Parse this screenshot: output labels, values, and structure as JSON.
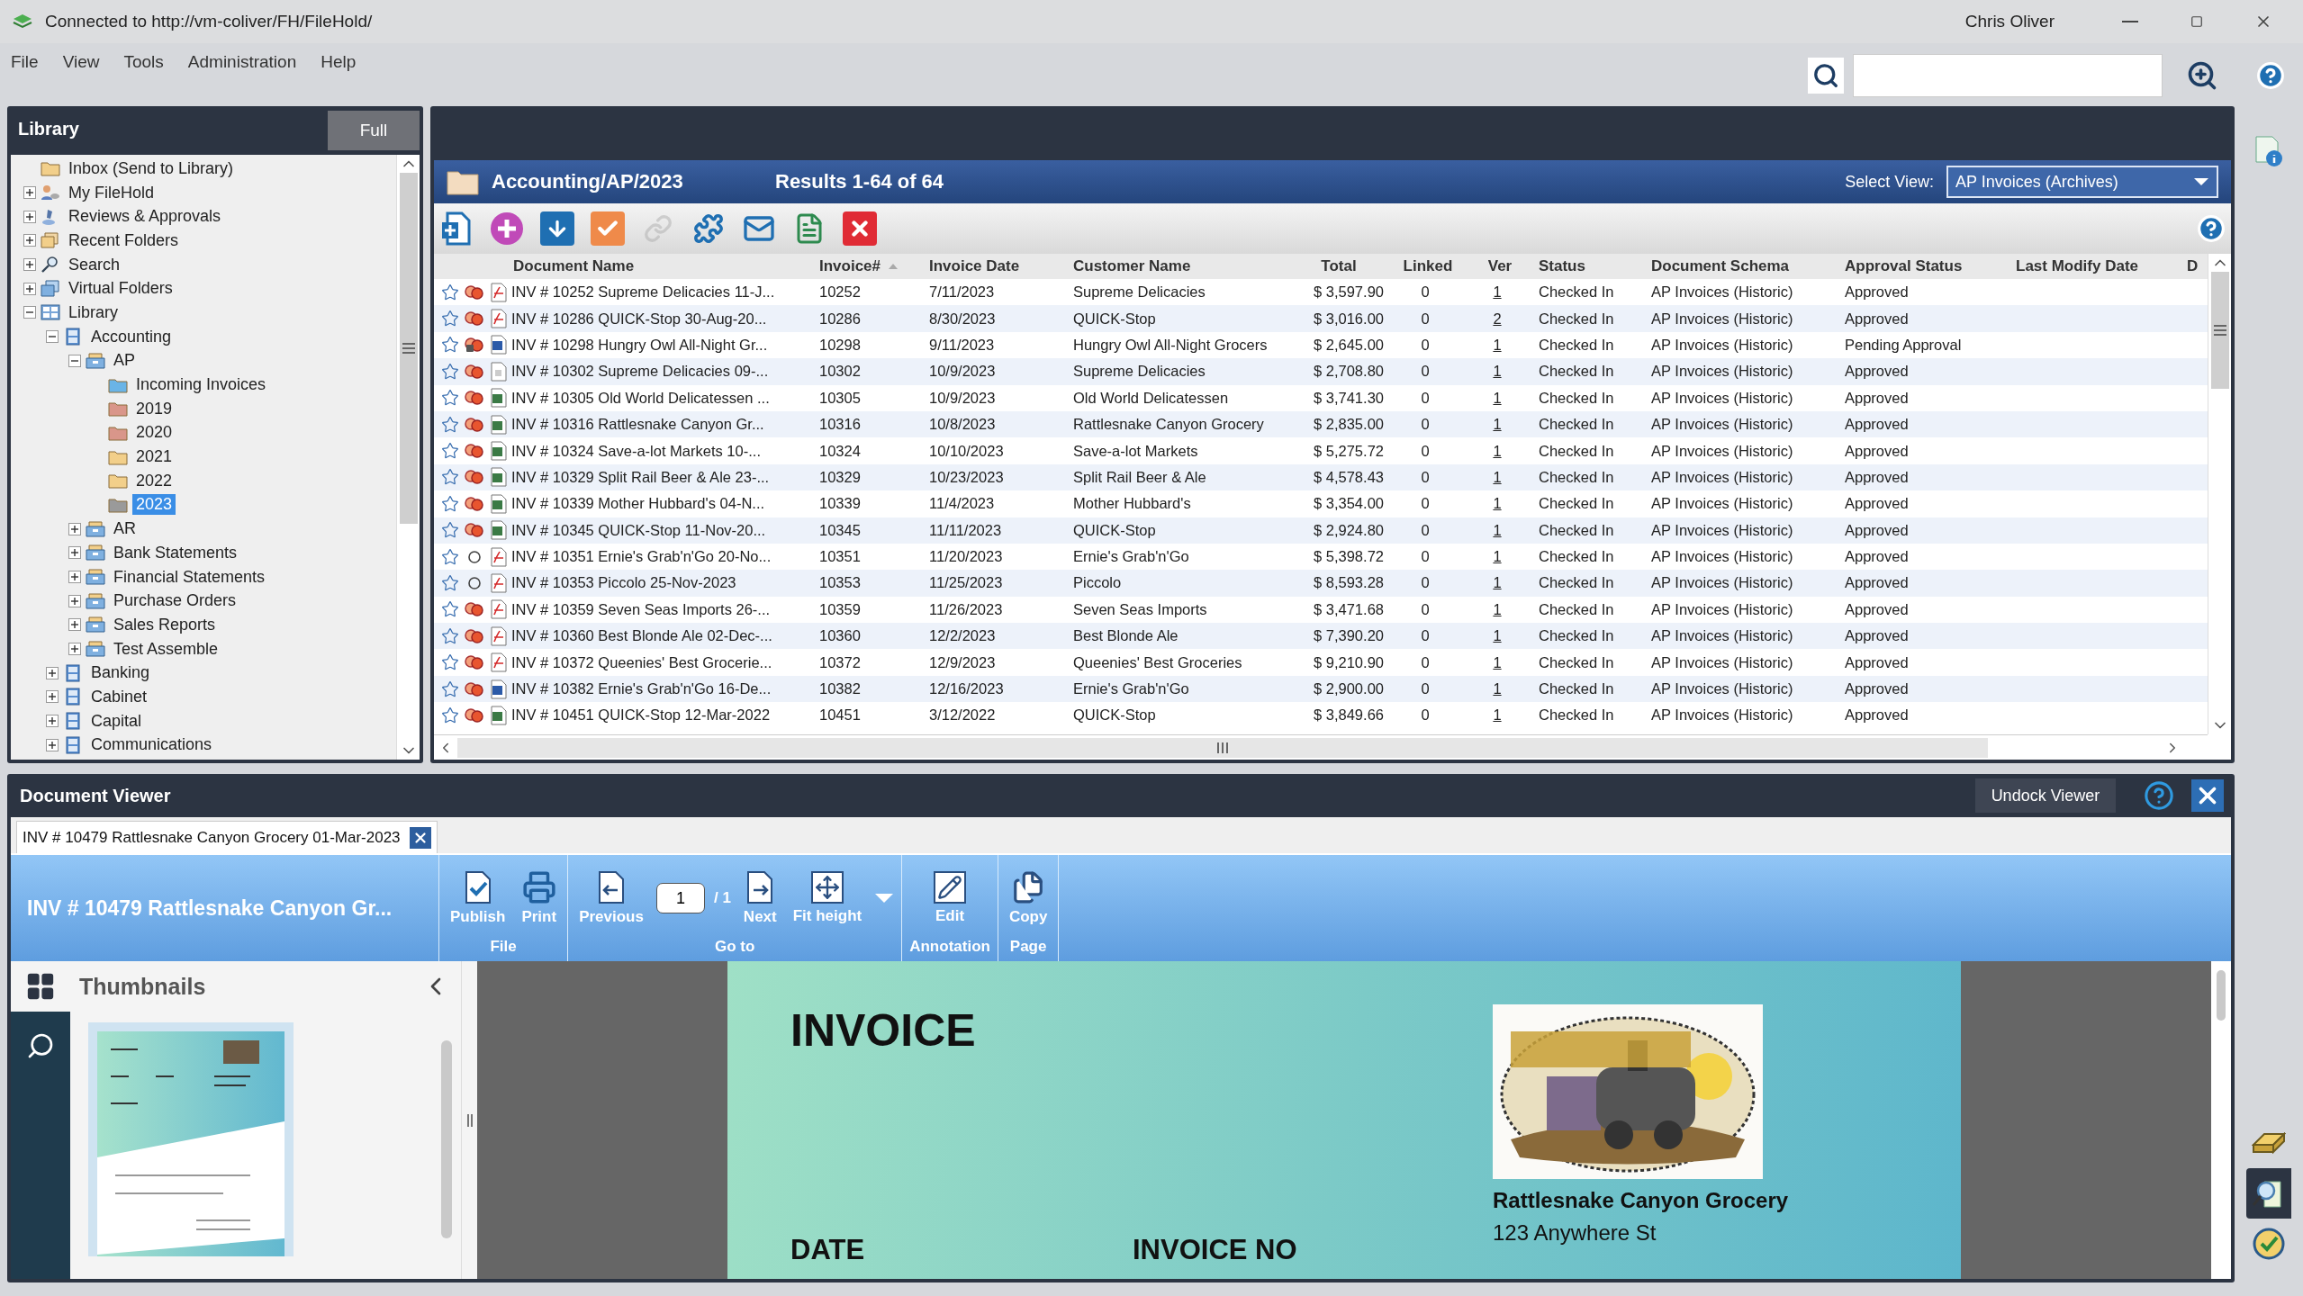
{
  "window": {
    "title": "Connected to http://vm-coliver/FH/FileHold/",
    "user": "Chris Oliver"
  },
  "menu": [
    "File",
    "View",
    "Tools",
    "Administration",
    "Help"
  ],
  "library": {
    "title": "Library",
    "mode_button": "Full",
    "tree": [
      {
        "label": "Inbox (Send to Library)",
        "kind": "folder",
        "color": "#f2cf8a",
        "selected": false
      },
      {
        "label": "My FileHold",
        "kind": "user",
        "expanded": false,
        "selected": false
      },
      {
        "label": "Reviews & Approvals",
        "kind": "reviews",
        "expanded": false,
        "selected": false
      },
      {
        "label": "Recent Folders",
        "kind": "recent",
        "expanded": false,
        "selected": false
      },
      {
        "label": "Search",
        "kind": "search",
        "expanded": false,
        "selected": false
      },
      {
        "label": "Virtual Folders",
        "kind": "virtual",
        "expanded": false,
        "selected": false
      },
      {
        "label": "Library",
        "kind": "library",
        "expanded": true,
        "selected": false,
        "children": [
          {
            "label": "Accounting",
            "kind": "cabinet",
            "expanded": true,
            "selected": false,
            "children": [
              {
                "label": "AP",
                "kind": "drawer",
                "expanded": true,
                "selected": false,
                "children": [
                  {
                    "label": "Incoming Invoices",
                    "kind": "folder",
                    "color": "#6ab4e6",
                    "selected": false
                  },
                  {
                    "label": "2019",
                    "kind": "folder",
                    "color": "#d9968a",
                    "selected": false
                  },
                  {
                    "label": "2020",
                    "kind": "folder",
                    "color": "#d9968a",
                    "selected": false
                  },
                  {
                    "label": "2021",
                    "kind": "folder",
                    "color": "#f2cf8a",
                    "selected": false
                  },
                  {
                    "label": "2022",
                    "kind": "folder",
                    "color": "#f2cf8a",
                    "selected": false
                  },
                  {
                    "label": "2023",
                    "kind": "folder",
                    "color": "#9a9a9a",
                    "selected": true
                  }
                ]
              },
              {
                "label": "AR",
                "kind": "drawer",
                "expanded": false,
                "selected": false
              },
              {
                "label": "Bank Statements",
                "kind": "drawer",
                "expanded": false,
                "selected": false
              },
              {
                "label": "Financial Statements",
                "kind": "drawer",
                "expanded": false,
                "selected": false
              },
              {
                "label": "Purchase Orders",
                "kind": "drawer",
                "expanded": false,
                "selected": false
              },
              {
                "label": "Sales Reports",
                "kind": "drawer",
                "expanded": false,
                "selected": false
              },
              {
                "label": "Test Assemble",
                "kind": "drawer",
                "expanded": false,
                "selected": false
              }
            ]
          },
          {
            "label": "Banking",
            "kind": "cabinet",
            "expanded": false,
            "selected": false
          },
          {
            "label": "Cabinet",
            "kind": "cabinet",
            "expanded": false,
            "selected": false
          },
          {
            "label": "Capital",
            "kind": "cabinet",
            "expanded": false,
            "selected": false
          },
          {
            "label": "Communications",
            "kind": "cabinet",
            "expanded": false,
            "selected": false
          }
        ]
      }
    ]
  },
  "results": {
    "path": "Accounting/AP/2023",
    "count": "Results 1-64 of 64",
    "view_label": "Select View:",
    "view": "AP Invoices (Archives)",
    "toolbar": [
      {
        "kind": "add-document",
        "disabled": false
      },
      {
        "kind": "add",
        "disabled": false
      },
      {
        "kind": "download",
        "disabled": false
      },
      {
        "kind": "approve",
        "disabled": false
      },
      {
        "kind": "link",
        "disabled": true
      },
      {
        "kind": "swap",
        "disabled": false
      },
      {
        "kind": "email",
        "disabled": false
      },
      {
        "kind": "document-list",
        "disabled": false
      },
      {
        "kind": "delete",
        "disabled": false
      }
    ],
    "columns": [
      {
        "label": "Document Name",
        "sorted": false
      },
      {
        "label": "Invoice#",
        "sorted": true
      },
      {
        "label": "Invoice Date",
        "sorted": false
      },
      {
        "label": "Customer Name",
        "sorted": false
      },
      {
        "label": "Total",
        "sorted": false
      },
      {
        "label": "Linked",
        "sorted": false
      },
      {
        "label": "Ver",
        "sorted": false
      },
      {
        "label": "Status",
        "sorted": false
      },
      {
        "label": "Document Schema",
        "sorted": false
      },
      {
        "label": "Approval Status",
        "sorted": false
      },
      {
        "label": "Last Modify Date",
        "sorted": false
      },
      {
        "label": "D",
        "sorted": false
      }
    ],
    "rows": [
      {
        "starred": false,
        "workflow": true,
        "locked": false,
        "kind": "pdf",
        "name": "INV # 10252 Supreme Delicacies 11-J...",
        "invoice": "10252",
        "date": "7/11/2023",
        "customer": "Supreme Delicacies",
        "total": "$ 3,597.90",
        "linked": "0",
        "ver": "1",
        "status": "Checked In",
        "schema": "AP Invoices (Historic)",
        "approval": "Approved"
      },
      {
        "starred": false,
        "workflow": true,
        "locked": false,
        "kind": "pdf",
        "name": "INV # 10286 QUICK-Stop 30-Aug-20...",
        "invoice": "10286",
        "date": "8/30/2023",
        "customer": "QUICK-Stop",
        "total": "$ 3,016.00",
        "linked": "0",
        "ver": "2",
        "status": "Checked In",
        "schema": "AP Invoices (Historic)",
        "approval": "Approved"
      },
      {
        "starred": false,
        "workflow": true,
        "locked": true,
        "kind": "word",
        "name": "INV # 10298 Hungry Owl All-Night Gr...",
        "invoice": "10298",
        "date": "9/11/2023",
        "customer": "Hungry Owl All-Night Grocers",
        "total": "$ 2,645.00",
        "linked": "0",
        "ver": "1",
        "status": "Checked In",
        "schema": "AP Invoices (Historic)",
        "approval": "Pending Approval"
      },
      {
        "starred": false,
        "workflow": true,
        "locked": false,
        "kind": "generic",
        "name": "INV # 10302 Supreme Delicacies 09-...",
        "invoice": "10302",
        "date": "10/9/2023",
        "customer": "Supreme Delicacies",
        "total": "$ 2,708.80",
        "linked": "0",
        "ver": "1",
        "status": "Checked In",
        "schema": "AP Invoices (Historic)",
        "approval": "Approved"
      },
      {
        "starred": false,
        "workflow": true,
        "locked": false,
        "kind": "excel",
        "name": "INV # 10305 Old World Delicatessen ...",
        "invoice": "10305",
        "date": "10/9/2023",
        "customer": "Old World Delicatessen",
        "total": "$ 3,741.30",
        "linked": "0",
        "ver": "1",
        "status": "Checked In",
        "schema": "AP Invoices (Historic)",
        "approval": "Approved"
      },
      {
        "starred": false,
        "workflow": true,
        "locked": false,
        "kind": "excel",
        "name": "INV # 10316 Rattlesnake Canyon Gr...",
        "invoice": "10316",
        "date": "10/8/2023",
        "customer": "Rattlesnake Canyon Grocery",
        "total": "$ 2,835.00",
        "linked": "0",
        "ver": "1",
        "status": "Checked In",
        "schema": "AP Invoices (Historic)",
        "approval": "Approved"
      },
      {
        "starred": false,
        "workflow": true,
        "locked": false,
        "kind": "excel",
        "name": "INV # 10324 Save-a-lot Markets 10-...",
        "invoice": "10324",
        "date": "10/10/2023",
        "customer": "Save-a-lot Markets",
        "total": "$ 5,275.72",
        "linked": "0",
        "ver": "1",
        "status": "Checked In",
        "schema": "AP Invoices (Historic)",
        "approval": "Approved"
      },
      {
        "starred": false,
        "workflow": true,
        "locked": false,
        "kind": "excel",
        "name": "INV # 10329 Split Rail Beer & Ale 23-...",
        "invoice": "10329",
        "date": "10/23/2023",
        "customer": "Split Rail Beer & Ale",
        "total": "$ 4,578.43",
        "linked": "0",
        "ver": "1",
        "status": "Checked In",
        "schema": "AP Invoices (Historic)",
        "approval": "Approved"
      },
      {
        "starred": false,
        "workflow": true,
        "locked": false,
        "kind": "excel",
        "name": "INV # 10339 Mother Hubbard's 04-N...",
        "invoice": "10339",
        "date": "11/4/2023",
        "customer": "Mother Hubbard's",
        "total": "$ 3,354.00",
        "linked": "0",
        "ver": "1",
        "status": "Checked In",
        "schema": "AP Invoices (Historic)",
        "approval": "Approved"
      },
      {
        "starred": false,
        "workflow": true,
        "locked": false,
        "kind": "excel",
        "name": "INV # 10345 QUICK-Stop 11-Nov-20...",
        "invoice": "10345",
        "date": "11/11/2023",
        "customer": "QUICK-Stop",
        "total": "$ 2,924.80",
        "linked": "0",
        "ver": "1",
        "status": "Checked In",
        "schema": "AP Invoices (Historic)",
        "approval": "Approved"
      },
      {
        "starred": false,
        "workflow": false,
        "locked": false,
        "kind": "pdf",
        "name": "INV # 10351 Ernie's Grab'n'Go 20-No...",
        "invoice": "10351",
        "date": "11/20/2023",
        "customer": "Ernie's Grab'n'Go",
        "total": "$ 5,398.72",
        "linked": "0",
        "ver": "1",
        "status": "Checked In",
        "schema": "AP Invoices (Historic)",
        "approval": "Approved"
      },
      {
        "starred": false,
        "workflow": false,
        "locked": false,
        "kind": "pdf",
        "name": "INV # 10353 Piccolo 25-Nov-2023",
        "invoice": "10353",
        "date": "11/25/2023",
        "customer": "Piccolo",
        "total": "$ 8,593.28",
        "linked": "0",
        "ver": "1",
        "status": "Checked In",
        "schema": "AP Invoices (Historic)",
        "approval": "Approved"
      },
      {
        "starred": false,
        "workflow": true,
        "locked": false,
        "kind": "pdf",
        "name": "INV # 10359 Seven Seas Imports 26-...",
        "invoice": "10359",
        "date": "11/26/2023",
        "customer": "Seven Seas Imports",
        "total": "$ 3,471.68",
        "linked": "0",
        "ver": "1",
        "status": "Checked In",
        "schema": "AP Invoices (Historic)",
        "approval": "Approved"
      },
      {
        "starred": false,
        "workflow": true,
        "locked": false,
        "kind": "pdf",
        "name": "INV # 10360 Best Blonde Ale 02-Dec-...",
        "invoice": "10360",
        "date": "12/2/2023",
        "customer": "Best Blonde Ale",
        "total": "$ 7,390.20",
        "linked": "0",
        "ver": "1",
        "status": "Checked In",
        "schema": "AP Invoices (Historic)",
        "approval": "Approved"
      },
      {
        "starred": false,
        "workflow": true,
        "locked": false,
        "kind": "pdf",
        "name": "INV # 10372 Queenies' Best Grocerie...",
        "invoice": "10372",
        "date": "12/9/2023",
        "customer": "Queenies' Best Groceries",
        "total": "$ 9,210.90",
        "linked": "0",
        "ver": "1",
        "status": "Checked In",
        "schema": "AP Invoices (Historic)",
        "approval": "Approved"
      },
      {
        "starred": false,
        "workflow": true,
        "locked": false,
        "kind": "word",
        "name": "INV # 10382 Ernie's Grab'n'Go 16-De...",
        "invoice": "10382",
        "date": "12/16/2023",
        "customer": "Ernie's Grab'n'Go",
        "total": "$ 2,900.00",
        "linked": "0",
        "ver": "1",
        "status": "Checked In",
        "schema": "AP Invoices (Historic)",
        "approval": "Approved"
      },
      {
        "starred": false,
        "workflow": true,
        "locked": false,
        "kind": "excel",
        "name": "INV # 10451 QUICK-Stop 12-Mar-2022",
        "invoice": "10451",
        "date": "3/12/2022",
        "customer": "QUICK-Stop",
        "total": "$ 3,849.66",
        "linked": "0",
        "ver": "1",
        "status": "Checked In",
        "schema": "AP Invoices (Historic)",
        "approval": "Approved"
      }
    ]
  },
  "viewer": {
    "title": "Document Viewer",
    "undock": "Undock Viewer",
    "tab": "INV # 10479 Rattlesnake Canyon Grocery 01-Mar-2023",
    "ribbon": {
      "title": "INV # 10479 Rattlesnake Canyon Gr...",
      "groups": [
        {
          "label": "File",
          "items": [
            {
              "kind": "publish",
              "label": "Publish"
            },
            {
              "kind": "print",
              "label": "Print"
            }
          ]
        },
        {
          "label": "Go to",
          "items": [
            {
              "kind": "previous",
              "label": "Previous"
            },
            {
              "kind": "page-field",
              "value": "1"
            },
            {
              "kind": "page-total",
              "label": "/ 1"
            },
            {
              "kind": "next",
              "label": "Next"
            },
            {
              "kind": "fit-height",
              "label": "Fit height"
            },
            {
              "kind": "menu-caret"
            }
          ]
        },
        {
          "label": "Annotation",
          "items": [
            {
              "kind": "edit",
              "label": "Edit"
            }
          ]
        },
        {
          "label": "Page",
          "items": [
            {
              "kind": "copy",
              "label": "Copy"
            }
          ]
        }
      ]
    },
    "thumbnails": {
      "title": "Thumbnails"
    },
    "document": {
      "heading": "INVOICE",
      "labels": [
        "DATE",
        "INVOICE NO"
      ],
      "company": "Rattlesnake Canyon Grocery",
      "address": "123 Anywhere St"
    }
  }
}
